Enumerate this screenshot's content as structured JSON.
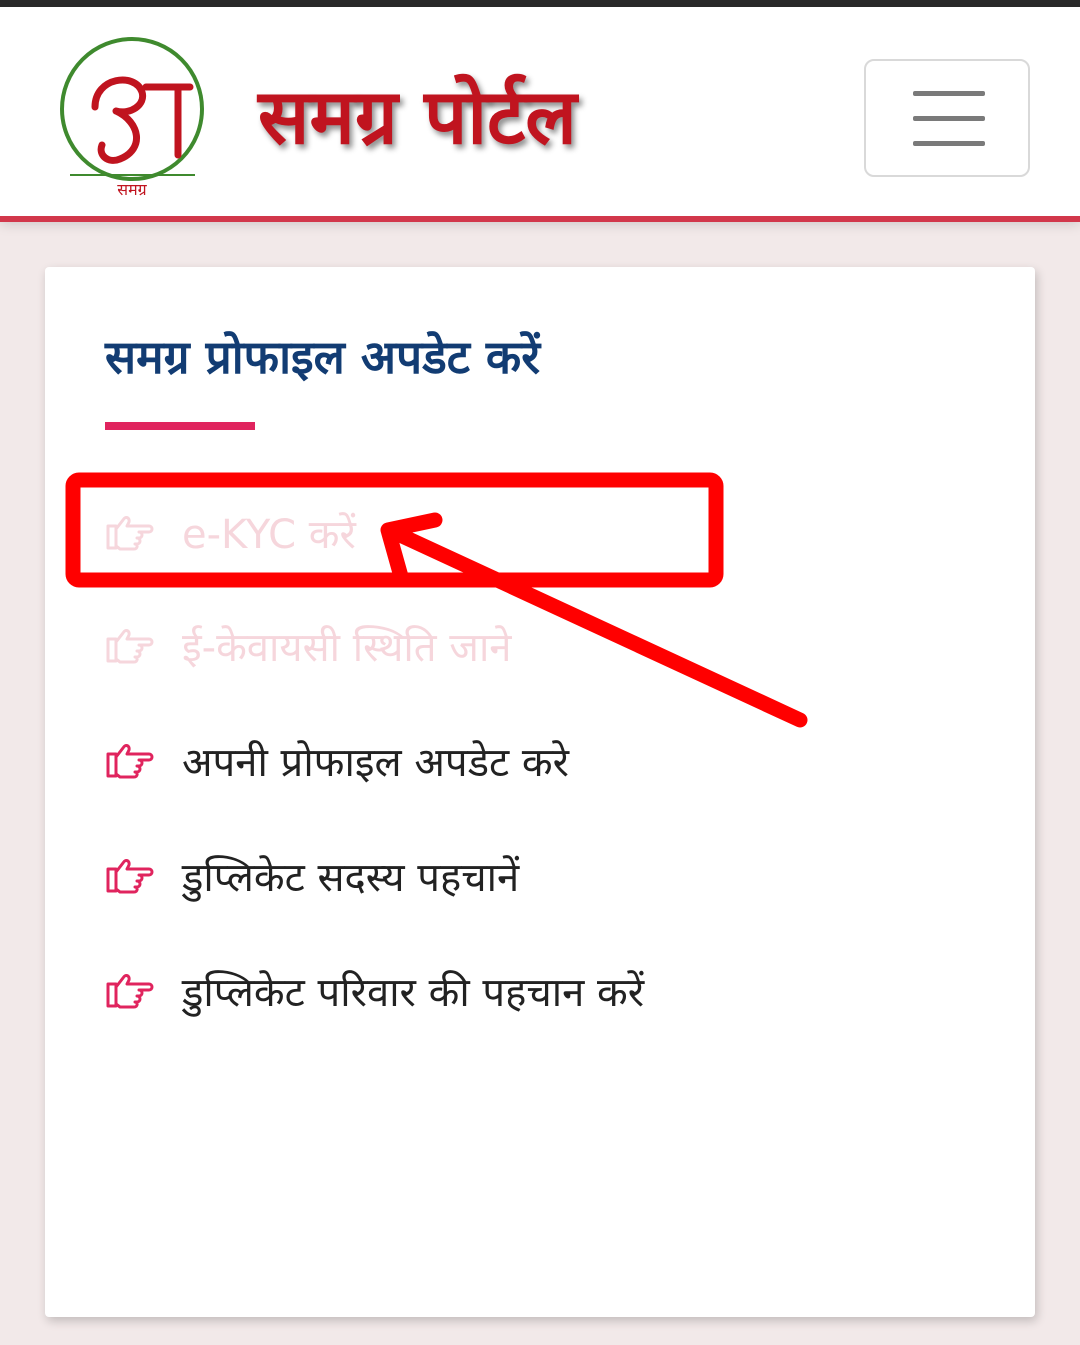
{
  "header": {
    "logo_label": "समग्र",
    "title": "समग्र पोर्टल",
    "accent_color": "#c0141f"
  },
  "card": {
    "title": "समग्र प्रोफाइल अपडेट करें",
    "items": [
      {
        "label": "e-KYC करें",
        "icon": "hand-pointing-right-icon"
      },
      {
        "label": "ई-केवायसी स्थिति जाने",
        "icon": "hand-pointing-right-icon"
      },
      {
        "label": "अपनी प्रोफाइल अपडेट करे",
        "icon": "hand-pointing-right-icon"
      },
      {
        "label": "डुप्लिकेट सदस्य पहचानें",
        "icon": "hand-pointing-right-icon"
      },
      {
        "label": "डुप्लिकेट परिवार की पहचान करें",
        "icon": "hand-pointing-right-icon"
      }
    ]
  },
  "colors": {
    "title_blue": "#123c73",
    "underline_pink": "#e0245e",
    "annotation_red": "#ff0000"
  }
}
